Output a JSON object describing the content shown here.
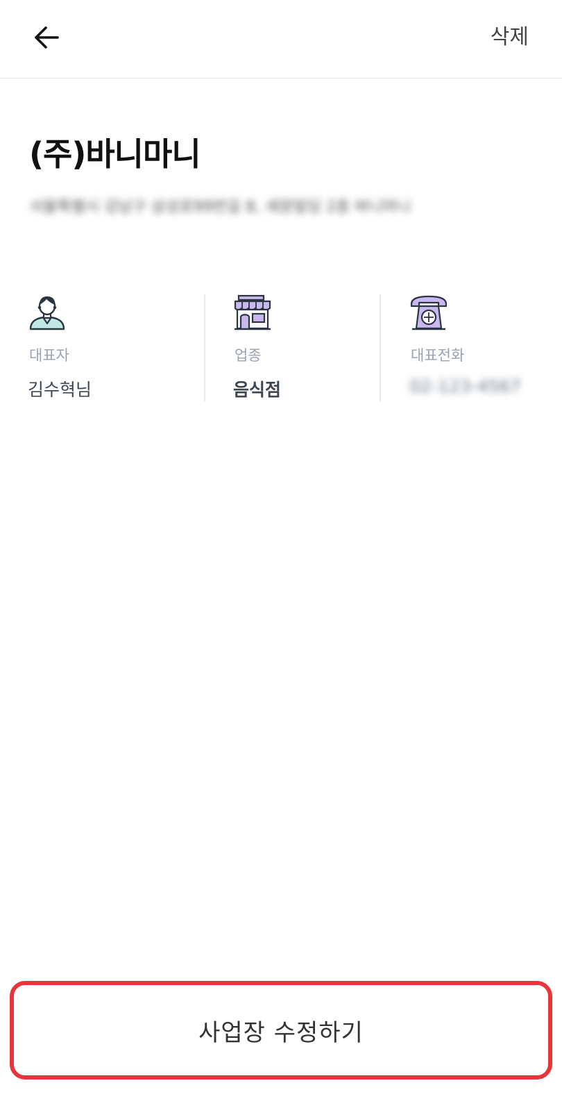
{
  "header": {
    "back_icon": "arrow-left-icon",
    "delete_label": "삭제"
  },
  "business": {
    "name": "(주)바니마니",
    "address": "서울특별시 강남구 삼성로99번길 8, 세원빌딩 2층 바니마니"
  },
  "info": {
    "representative": {
      "icon": "person-icon",
      "label": "대표자",
      "value": "김수혁님"
    },
    "category": {
      "icon": "storefront-icon",
      "label": "업종",
      "value": "음식점"
    },
    "phone": {
      "icon": "telephone-icon",
      "label": "대표전화",
      "value": "02-123-4567"
    }
  },
  "footer": {
    "edit_label": "사업장 수정하기"
  },
  "colors": {
    "accent_border": "#e8353b",
    "icon_teal": "#bfe7e3",
    "icon_purple": "#c9b8ee"
  }
}
